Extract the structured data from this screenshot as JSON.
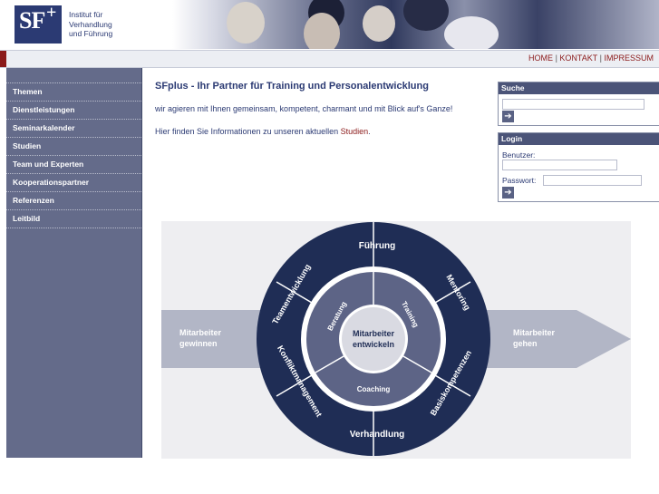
{
  "logo": {
    "mark_left": "SF",
    "mark_plus": "+",
    "line1": "Institut für",
    "line2": "Verhandlung",
    "line3": "und Führung"
  },
  "topnav": {
    "home": "HOME",
    "kontakt": "KONTAKT",
    "impressum": "IMPRESSUM",
    "separator": "|"
  },
  "sidebar": {
    "items": [
      {
        "label": "Themen"
      },
      {
        "label": "Dienstleistungen"
      },
      {
        "label": "Seminarkalender"
      },
      {
        "label": "Studien"
      },
      {
        "label": "Team und Experten"
      },
      {
        "label": "Kooperationspartner"
      },
      {
        "label": "Referenzen"
      },
      {
        "label": "Leitbild"
      }
    ]
  },
  "main": {
    "title": "SFplus - Ihr Partner für Training und Personalentwicklung",
    "para1": "wir agieren mit Ihnen gemeinsam, kompetent, charmant und mit Blick auf's Ganze!",
    "para2_pre": "Hier finden Sie Informationen zu unseren aktuellen ",
    "para2_link": "Studien",
    "para2_post": "."
  },
  "search": {
    "title": "Suche",
    "value": "",
    "button": "➔"
  },
  "login": {
    "title": "Login",
    "user_label": "Benutzer:",
    "pass_label": "Passwort:",
    "user_value": "",
    "pass_value": "",
    "button": "➔"
  },
  "diagram": {
    "left_arrow": [
      "Mitarbeiter",
      "gewinnen"
    ],
    "right_arrow": [
      "Mitarbeiter",
      "gehen"
    ],
    "center": [
      "Mitarbeiter",
      "entwickeln"
    ],
    "inner": [
      "Beratung",
      "Training",
      "Coaching"
    ],
    "outer": [
      "Führung",
      "Mentoring",
      "Basiskompetenzen",
      "Verhandlung",
      "Konfliktmanagement",
      "Teamentwicklung"
    ],
    "colors": {
      "outer": "#1f2d55",
      "inner": "#5d6486",
      "center": "#d9dae2",
      "ring": "#ffffff",
      "arrow": "#b2b6c6"
    }
  }
}
